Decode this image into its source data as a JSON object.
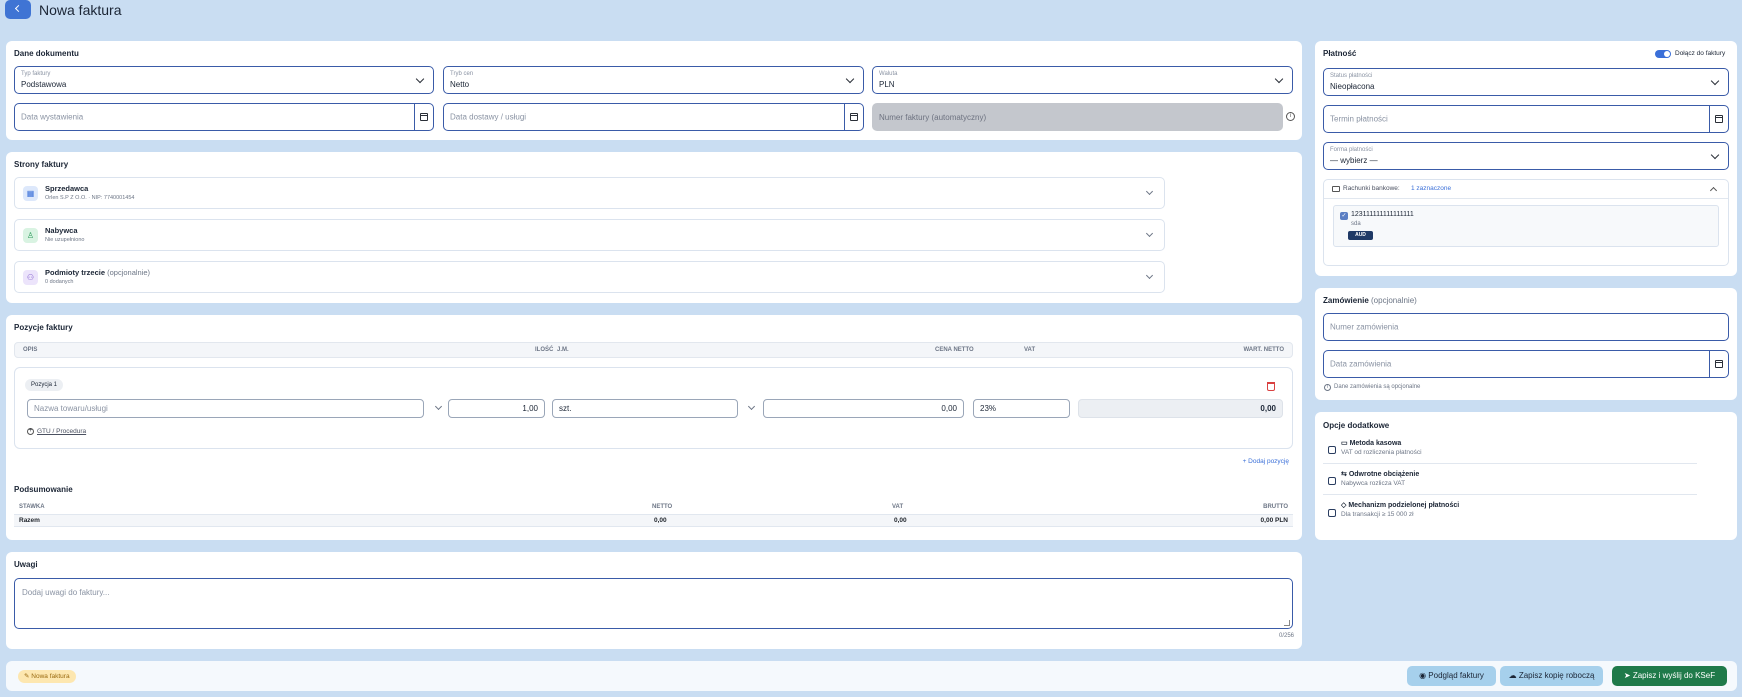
{
  "header": {
    "title": "Nowa faktura",
    "back_icon": "chevron-left-icon"
  },
  "doc": {
    "title": "Dane dokumentu",
    "type_label": "Typ faktury",
    "type_value": "Podstawowa",
    "mode_label": "Tryb cen",
    "mode_value": "Netto",
    "currency_label": "Waluta",
    "currency_value": "PLN",
    "issue_date_placeholder": "Data wystawienia",
    "delivery_date_placeholder": "Data dostawy / usługi",
    "number_placeholder": "Numer faktury (automatyczny)"
  },
  "parties": {
    "title": "Strony faktury",
    "seller_title": "Sprzedawca",
    "seller_sub": "Orlen S.P Z O.O. · NIP: 7740001454",
    "buyer_title": "Nabywca",
    "buyer_sub": "Nie uzupełniono",
    "third_title": "Podmioty trzecie",
    "third_opt": " (opcjonalnie)",
    "third_sub": "0 dodanych"
  },
  "items": {
    "title": "Pozycje faktury",
    "col_desc": "OPIS",
    "col_qty": "ILOŚĆ",
    "col_unit": "J.M.",
    "col_price": "CENA NETTO",
    "col_vat": "VAT",
    "col_value": "WART. NETTO",
    "position_label": "Pozycja 1",
    "name_placeholder": "Nazwa towaru/usługi",
    "qty": "1,00",
    "unit": "szt.",
    "price": "0,00",
    "vat": "23%",
    "value": "0,00",
    "gtu": "GTU / Procedura",
    "add_label": "+ Dodaj pozycję"
  },
  "summary": {
    "title": "Podsumowanie",
    "col_rate": "STAWKA",
    "col_net": "NETTO",
    "col_vat": "VAT",
    "col_gross": "BRUTTO",
    "row_label": "Razem",
    "row_net": "0,00",
    "row_vat": "0,00",
    "row_gross": "0,00 PLN"
  },
  "notes": {
    "title": "Uwagi",
    "placeholder": "Dodaj uwagi do faktury...",
    "counter": "0/256"
  },
  "payment": {
    "title": "Płatność",
    "toggle_label": "Dołącz do faktury",
    "status_label": "Status płatności",
    "status_value": "Nieopłacona",
    "due_placeholder": "Termin płatności",
    "form_label": "Forma płatności",
    "form_value": "— wybierz —",
    "bank_label": "Rachunki bankowe:",
    "bank_selected": "1 zaznaczone",
    "account_number": "123111111111111111",
    "account_name": "sda",
    "account_currency": "AUD"
  },
  "order": {
    "title": "Zamówienie",
    "title_opt": " (opcjonalnie)",
    "number_placeholder": "Numer zamówienia",
    "date_placeholder": "Data zamówienia",
    "hint": "Dane zamówienia są opcjonalne"
  },
  "options": {
    "title": "Opcje dodatkowe",
    "o1_title": "Metoda kasowa",
    "o1_sub": "VAT od rozliczenia płatności",
    "o2_title": "Odwrotne obciążenie",
    "o2_sub": "Nabywca rozlicza VAT",
    "o3_title": "Mechanizm podzielonej płatności",
    "o3_sub": "Dla transakcji ≥ 15 000 zł"
  },
  "footer": {
    "badge": "Nowa faktura",
    "preview": "Podgląd faktury",
    "draft": "Zapisz kopię roboczą",
    "send": "Zapisz i wyślij do KSeF"
  },
  "colors": {
    "accent": "#3a6fd8",
    "primary_dark": "#1f7a4a",
    "background": "#c9ddf2"
  }
}
